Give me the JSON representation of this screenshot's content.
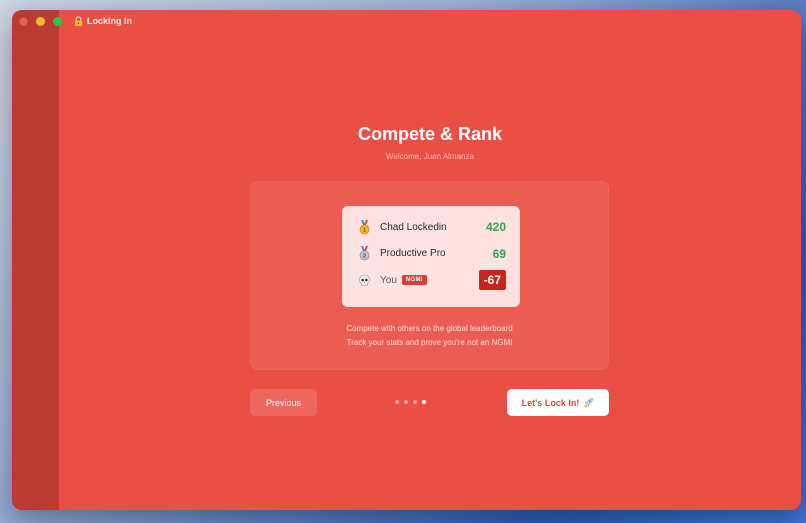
{
  "window": {
    "title": "Locking In",
    "title_icon": "locked-emoji-icon"
  },
  "onboarding": {
    "heading": "Compete & Rank",
    "welcome": "Welcome, Juan Almanza",
    "leaderboard": [
      {
        "rank_icon": "gold-medal-icon",
        "name": "Chad Lockedin",
        "score": "420"
      },
      {
        "rank_icon": "silver-medal-icon",
        "name": "Productive Pro",
        "score": "69"
      },
      {
        "rank_icon": "skull-icon",
        "name": "You",
        "badge": "NGMI",
        "score": "-67"
      }
    ],
    "caption_line1": "Compete with others on the global leaderboard",
    "caption_line2": "Track your stats and prove you're not an NGMI",
    "previous_label": "Previous",
    "next_label": "Let's Lock In!",
    "page_count": 4,
    "current_page": 4
  },
  "colors": {
    "background": "#ea4f45",
    "sidebar": "#b93b33",
    "score_positive": "#2fa74d",
    "score_negative": "#c8251c",
    "badge": "#e23a31"
  }
}
